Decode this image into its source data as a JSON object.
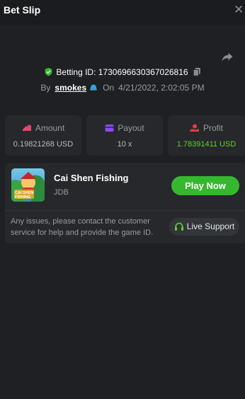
{
  "header": {
    "title": "Bet Slip",
    "close_icon": "close-icon"
  },
  "share_icon": "share-icon",
  "bet": {
    "id_text": "Betting ID: 1730696630367026816",
    "by_label": "By",
    "username": "smokes",
    "on_label": "On",
    "datetime": "4/21/2022, 2:02:05 PM"
  },
  "stats": {
    "amount": {
      "label": "Amount",
      "value": "0.19821268 USD",
      "icon": "coins-icon",
      "color": "#e8446f"
    },
    "payout": {
      "label": "Payout",
      "value": "10 x",
      "icon": "wallet-icon",
      "color": "#8a4cf0"
    },
    "profit": {
      "label": "Profit",
      "value": "1.78391411 USD",
      "icon": "money-hand-icon",
      "color": "#e63b3b",
      "value_color": "#5ed12c"
    }
  },
  "game": {
    "name": "Cai Shen Fishing",
    "provider": "JDB",
    "play_label": "Play Now"
  },
  "support": {
    "notice": "Any issues, please contact the customer service for help and provide the game ID.",
    "button_label": "Live Support"
  },
  "colors": {
    "background": "#1e2023",
    "panel": "#26282b",
    "accent_green": "#36b82e"
  }
}
